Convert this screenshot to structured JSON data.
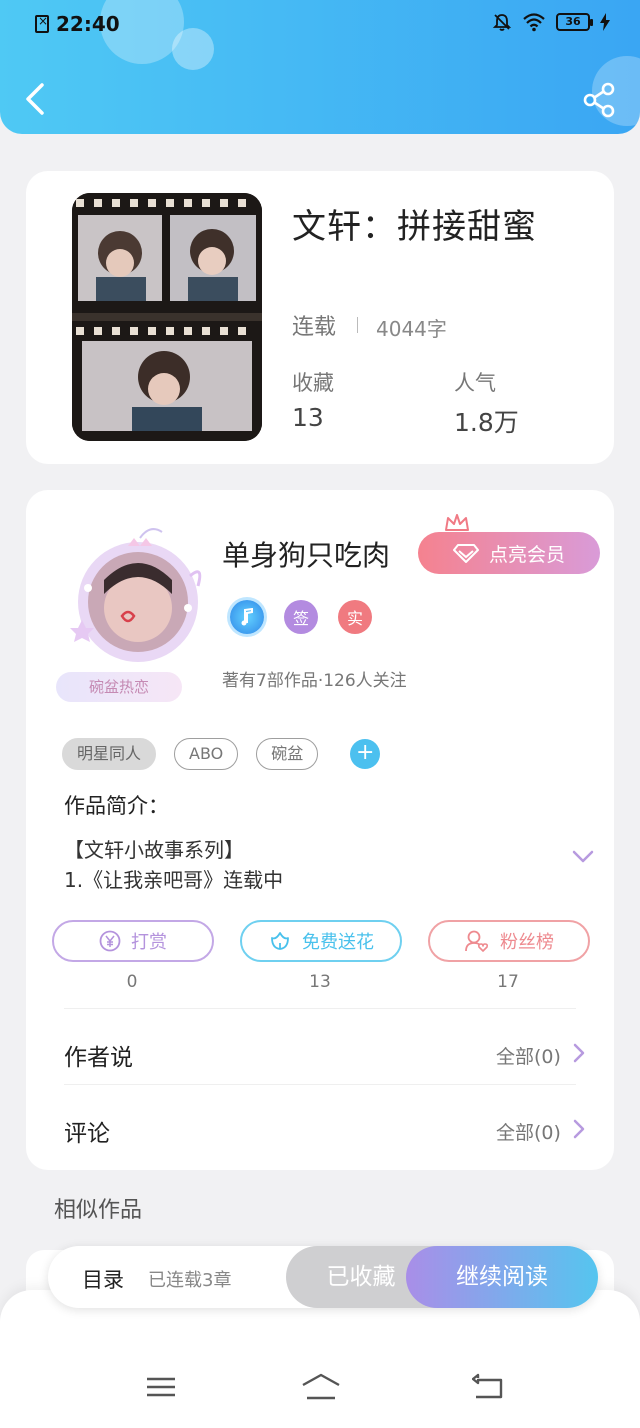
{
  "status_bar": {
    "time": "22:40",
    "battery": "36"
  },
  "book": {
    "title": "文轩：拼接甜蜜",
    "status": "连载",
    "word_count": "4044字",
    "stats": [
      {
        "label": "收藏",
        "value": "13"
      },
      {
        "label": "人气",
        "value": "1.8万"
      }
    ]
  },
  "author": {
    "name": "单身狗只吃肉",
    "avatar_badge": "碗盆热恋",
    "vip_button": "点亮会员",
    "badges": [
      {
        "icon": "music-icon",
        "label": "",
        "color": "#2f9bf0"
      },
      {
        "icon": "sign-badge",
        "label": "签",
        "color": "#b38be0"
      },
      {
        "icon": "real-badge",
        "label": "实",
        "color": "#f07a80"
      }
    ],
    "stats_text": "著有7部作品·126人关注"
  },
  "tags": [
    {
      "label": "明星同人",
      "filled": true
    },
    {
      "label": "ABO",
      "filled": false
    },
    {
      "label": "碗盆",
      "filled": false
    }
  ],
  "intro": {
    "title": "作品简介：",
    "lines": [
      "【文轩小故事系列】",
      "1.《让我亲吧哥》连载中"
    ]
  },
  "actions": [
    {
      "label": "打赏",
      "count": "0",
      "color": "#b493dd",
      "icon": "yen-icon"
    },
    {
      "label": "免费送花",
      "count": "13",
      "color": "#49c1ec",
      "icon": "flower-icon"
    },
    {
      "label": "粉丝榜",
      "count": "17",
      "color": "#ee8a8f",
      "icon": "fans-icon"
    }
  ],
  "sections": [
    {
      "label": "作者说",
      "right": "全部(0)"
    },
    {
      "label": "评论",
      "right": "全部(0)"
    }
  ],
  "similar_title": "相似作品",
  "bottom_bar": {
    "toc_label": "目录",
    "toc_count": "已连载3章",
    "collected_label": "已收藏",
    "read_label": "继续阅读"
  },
  "colors": {
    "header_start": "#4fc9f4",
    "header_end": "#3aa6f3",
    "accent_purple": "#a98ee8",
    "accent_blue": "#55c5ef"
  }
}
